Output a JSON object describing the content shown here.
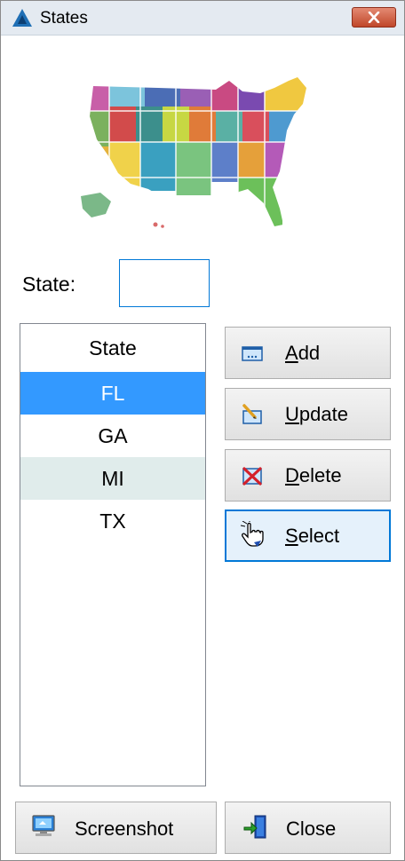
{
  "window": {
    "title": "States",
    "app_icon": "app-triangle-icon",
    "close_icon": "close-x-icon"
  },
  "map": {
    "name": "usa-map-image"
  },
  "form": {
    "state_label": "State:",
    "state_value": ""
  },
  "list": {
    "header": "State",
    "items": [
      "FL",
      "GA",
      "MI",
      "TX"
    ],
    "selected": "FL"
  },
  "buttons": {
    "add": {
      "prefix": "",
      "mnemonic": "A",
      "rest": "dd",
      "icon": "add-form-icon"
    },
    "update": {
      "prefix": "",
      "mnemonic": "U",
      "rest": "pdate",
      "icon": "edit-pencil-icon"
    },
    "delete": {
      "prefix": "",
      "mnemonic": "D",
      "rest": "elete",
      "icon": "delete-x-icon"
    },
    "select": {
      "prefix": "",
      "mnemonic": "S",
      "rest": "elect",
      "icon": "hand-pointer-icon"
    },
    "screenshot": {
      "label": "Screenshot",
      "icon": "monitor-icon"
    },
    "close": {
      "label": "Close",
      "icon": "exit-door-icon"
    }
  },
  "colors": {
    "selection": "#3399ff",
    "focus_border": "#0078d7",
    "alt_row": "#e0eceb",
    "title_bar": "#e4eaf1",
    "close_button": "#c0472a"
  }
}
